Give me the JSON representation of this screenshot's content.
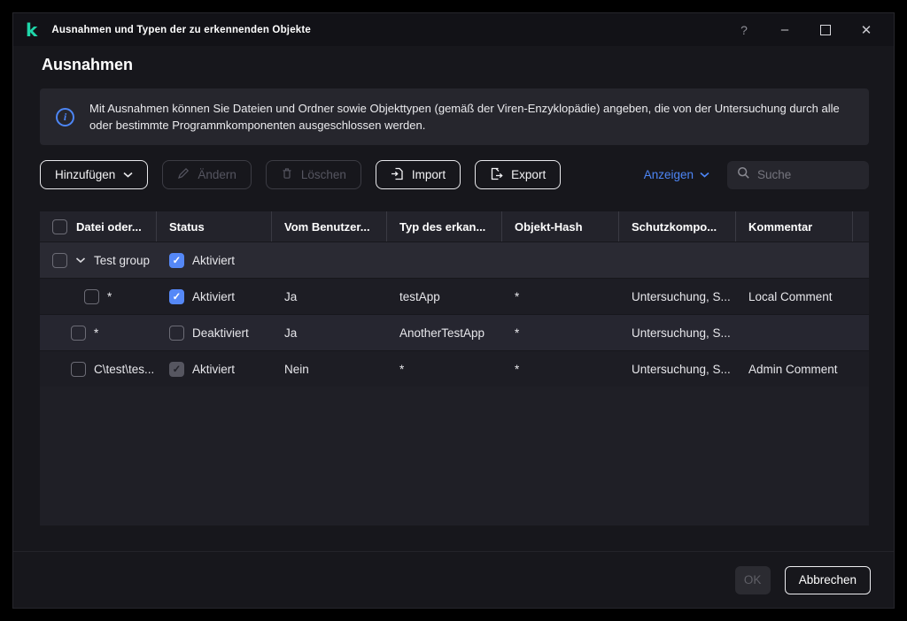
{
  "window": {
    "title": "Ausnahmen und Typen der zu erkennenden Objekte",
    "controls": {
      "help": "?",
      "minimize": "–",
      "close": "✕"
    }
  },
  "page": {
    "title": "Ausnahmen"
  },
  "banner": {
    "text": "Mit Ausnahmen können Sie Dateien und Ordner sowie Objekttypen (gemäß der Viren-Enzyklopädie) angeben, die von der Untersuchung durch alle oder bestimmte Programmkomponenten ausgeschlossen werden."
  },
  "toolbar": {
    "add_label": "Hinzufügen",
    "edit_label": "Ändern",
    "delete_label": "Löschen",
    "import_label": "Import",
    "export_label": "Export",
    "view_label": "Anzeigen",
    "search_placeholder": "Suche"
  },
  "table": {
    "columns": [
      "Datei oder...",
      "Status",
      "Vom Benutzer...",
      "Typ des erkan...",
      "Objekt-Hash",
      "Schutzkompo...",
      "Kommentar"
    ],
    "rows": [
      {
        "name": "Test group",
        "status": "Aktiviert"
      },
      {
        "file": "*",
        "status": "Aktiviert",
        "added_by_user": "Ja",
        "object_type": "testApp",
        "hash": "*",
        "components": "Untersuchung, S...",
        "comment": "Local Comment"
      },
      {
        "file": "*",
        "status": "Deaktiviert",
        "added_by_user": "Ja",
        "object_type": "AnotherTestApp",
        "hash": "*",
        "components": "Untersuchung, S...",
        "comment": ""
      },
      {
        "file": "C\\test\\tes...",
        "status": "Aktiviert",
        "added_by_user": "Nein",
        "object_type": "*",
        "hash": "*",
        "components": "Untersuchung, S...",
        "comment": "Admin Comment"
      }
    ]
  },
  "footer": {
    "ok_label": "OK",
    "cancel_label": "Abbrechen"
  },
  "colors": {
    "accent_blue": "#4d86f6",
    "brand_teal": "#1fd6a9",
    "checkbox_checked": "#5588f7"
  }
}
